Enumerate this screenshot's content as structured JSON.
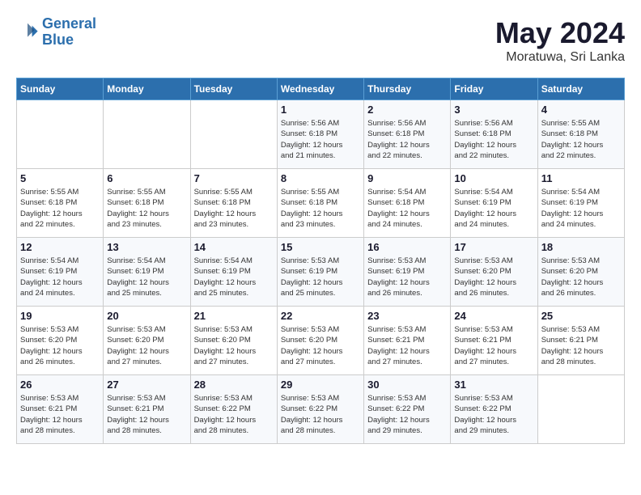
{
  "header": {
    "logo_line1": "General",
    "logo_line2": "Blue",
    "title": "May 2024",
    "subtitle": "Moratuwa, Sri Lanka"
  },
  "days_of_week": [
    "Sunday",
    "Monday",
    "Tuesday",
    "Wednesday",
    "Thursday",
    "Friday",
    "Saturday"
  ],
  "weeks": [
    [
      {
        "day": "",
        "info": ""
      },
      {
        "day": "",
        "info": ""
      },
      {
        "day": "",
        "info": ""
      },
      {
        "day": "1",
        "info": "Sunrise: 5:56 AM\nSunset: 6:18 PM\nDaylight: 12 hours\nand 21 minutes."
      },
      {
        "day": "2",
        "info": "Sunrise: 5:56 AM\nSunset: 6:18 PM\nDaylight: 12 hours\nand 22 minutes."
      },
      {
        "day": "3",
        "info": "Sunrise: 5:56 AM\nSunset: 6:18 PM\nDaylight: 12 hours\nand 22 minutes."
      },
      {
        "day": "4",
        "info": "Sunrise: 5:55 AM\nSunset: 6:18 PM\nDaylight: 12 hours\nand 22 minutes."
      }
    ],
    [
      {
        "day": "5",
        "info": "Sunrise: 5:55 AM\nSunset: 6:18 PM\nDaylight: 12 hours\nand 22 minutes."
      },
      {
        "day": "6",
        "info": "Sunrise: 5:55 AM\nSunset: 6:18 PM\nDaylight: 12 hours\nand 23 minutes."
      },
      {
        "day": "7",
        "info": "Sunrise: 5:55 AM\nSunset: 6:18 PM\nDaylight: 12 hours\nand 23 minutes."
      },
      {
        "day": "8",
        "info": "Sunrise: 5:55 AM\nSunset: 6:18 PM\nDaylight: 12 hours\nand 23 minutes."
      },
      {
        "day": "9",
        "info": "Sunrise: 5:54 AM\nSunset: 6:18 PM\nDaylight: 12 hours\nand 24 minutes."
      },
      {
        "day": "10",
        "info": "Sunrise: 5:54 AM\nSunset: 6:19 PM\nDaylight: 12 hours\nand 24 minutes."
      },
      {
        "day": "11",
        "info": "Sunrise: 5:54 AM\nSunset: 6:19 PM\nDaylight: 12 hours\nand 24 minutes."
      }
    ],
    [
      {
        "day": "12",
        "info": "Sunrise: 5:54 AM\nSunset: 6:19 PM\nDaylight: 12 hours\nand 24 minutes."
      },
      {
        "day": "13",
        "info": "Sunrise: 5:54 AM\nSunset: 6:19 PM\nDaylight: 12 hours\nand 25 minutes."
      },
      {
        "day": "14",
        "info": "Sunrise: 5:54 AM\nSunset: 6:19 PM\nDaylight: 12 hours\nand 25 minutes."
      },
      {
        "day": "15",
        "info": "Sunrise: 5:53 AM\nSunset: 6:19 PM\nDaylight: 12 hours\nand 25 minutes."
      },
      {
        "day": "16",
        "info": "Sunrise: 5:53 AM\nSunset: 6:19 PM\nDaylight: 12 hours\nand 26 minutes."
      },
      {
        "day": "17",
        "info": "Sunrise: 5:53 AM\nSunset: 6:20 PM\nDaylight: 12 hours\nand 26 minutes."
      },
      {
        "day": "18",
        "info": "Sunrise: 5:53 AM\nSunset: 6:20 PM\nDaylight: 12 hours\nand 26 minutes."
      }
    ],
    [
      {
        "day": "19",
        "info": "Sunrise: 5:53 AM\nSunset: 6:20 PM\nDaylight: 12 hours\nand 26 minutes."
      },
      {
        "day": "20",
        "info": "Sunrise: 5:53 AM\nSunset: 6:20 PM\nDaylight: 12 hours\nand 27 minutes."
      },
      {
        "day": "21",
        "info": "Sunrise: 5:53 AM\nSunset: 6:20 PM\nDaylight: 12 hours\nand 27 minutes."
      },
      {
        "day": "22",
        "info": "Sunrise: 5:53 AM\nSunset: 6:20 PM\nDaylight: 12 hours\nand 27 minutes."
      },
      {
        "day": "23",
        "info": "Sunrise: 5:53 AM\nSunset: 6:21 PM\nDaylight: 12 hours\nand 27 minutes."
      },
      {
        "day": "24",
        "info": "Sunrise: 5:53 AM\nSunset: 6:21 PM\nDaylight: 12 hours\nand 27 minutes."
      },
      {
        "day": "25",
        "info": "Sunrise: 5:53 AM\nSunset: 6:21 PM\nDaylight: 12 hours\nand 28 minutes."
      }
    ],
    [
      {
        "day": "26",
        "info": "Sunrise: 5:53 AM\nSunset: 6:21 PM\nDaylight: 12 hours\nand 28 minutes."
      },
      {
        "day": "27",
        "info": "Sunrise: 5:53 AM\nSunset: 6:21 PM\nDaylight: 12 hours\nand 28 minutes."
      },
      {
        "day": "28",
        "info": "Sunrise: 5:53 AM\nSunset: 6:22 PM\nDaylight: 12 hours\nand 28 minutes."
      },
      {
        "day": "29",
        "info": "Sunrise: 5:53 AM\nSunset: 6:22 PM\nDaylight: 12 hours\nand 28 minutes."
      },
      {
        "day": "30",
        "info": "Sunrise: 5:53 AM\nSunset: 6:22 PM\nDaylight: 12 hours\nand 29 minutes."
      },
      {
        "day": "31",
        "info": "Sunrise: 5:53 AM\nSunset: 6:22 PM\nDaylight: 12 hours\nand 29 minutes."
      },
      {
        "day": "",
        "info": ""
      }
    ]
  ]
}
